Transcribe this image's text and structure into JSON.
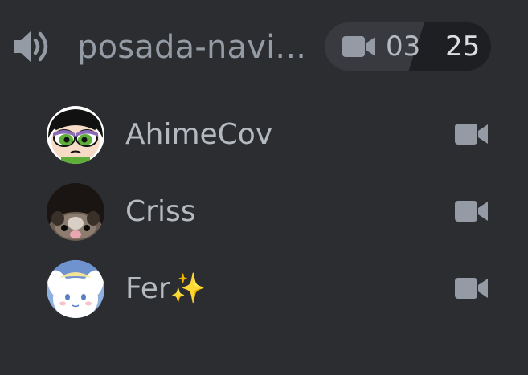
{
  "channel": {
    "icon": "speaker-icon",
    "name": "posada-navi...",
    "video_icon": "video-camera-icon",
    "video_count": "03",
    "user_limit": "25"
  },
  "users": [
    {
      "name": "AhimeCov",
      "avatar": "buttercup-avatar",
      "icon": "video-camera-icon"
    },
    {
      "name": "Criss",
      "avatar": "opossum-avatar",
      "icon": "video-camera-icon"
    },
    {
      "name": "Fer✨",
      "avatar": "cinnamoroll-avatar",
      "icon": "video-camera-icon"
    }
  ],
  "colors": {
    "background": "#2b2d31",
    "muted_text": "#949ba4",
    "pill_bg": "#383a40",
    "pill_dark": "#1e1f22"
  }
}
